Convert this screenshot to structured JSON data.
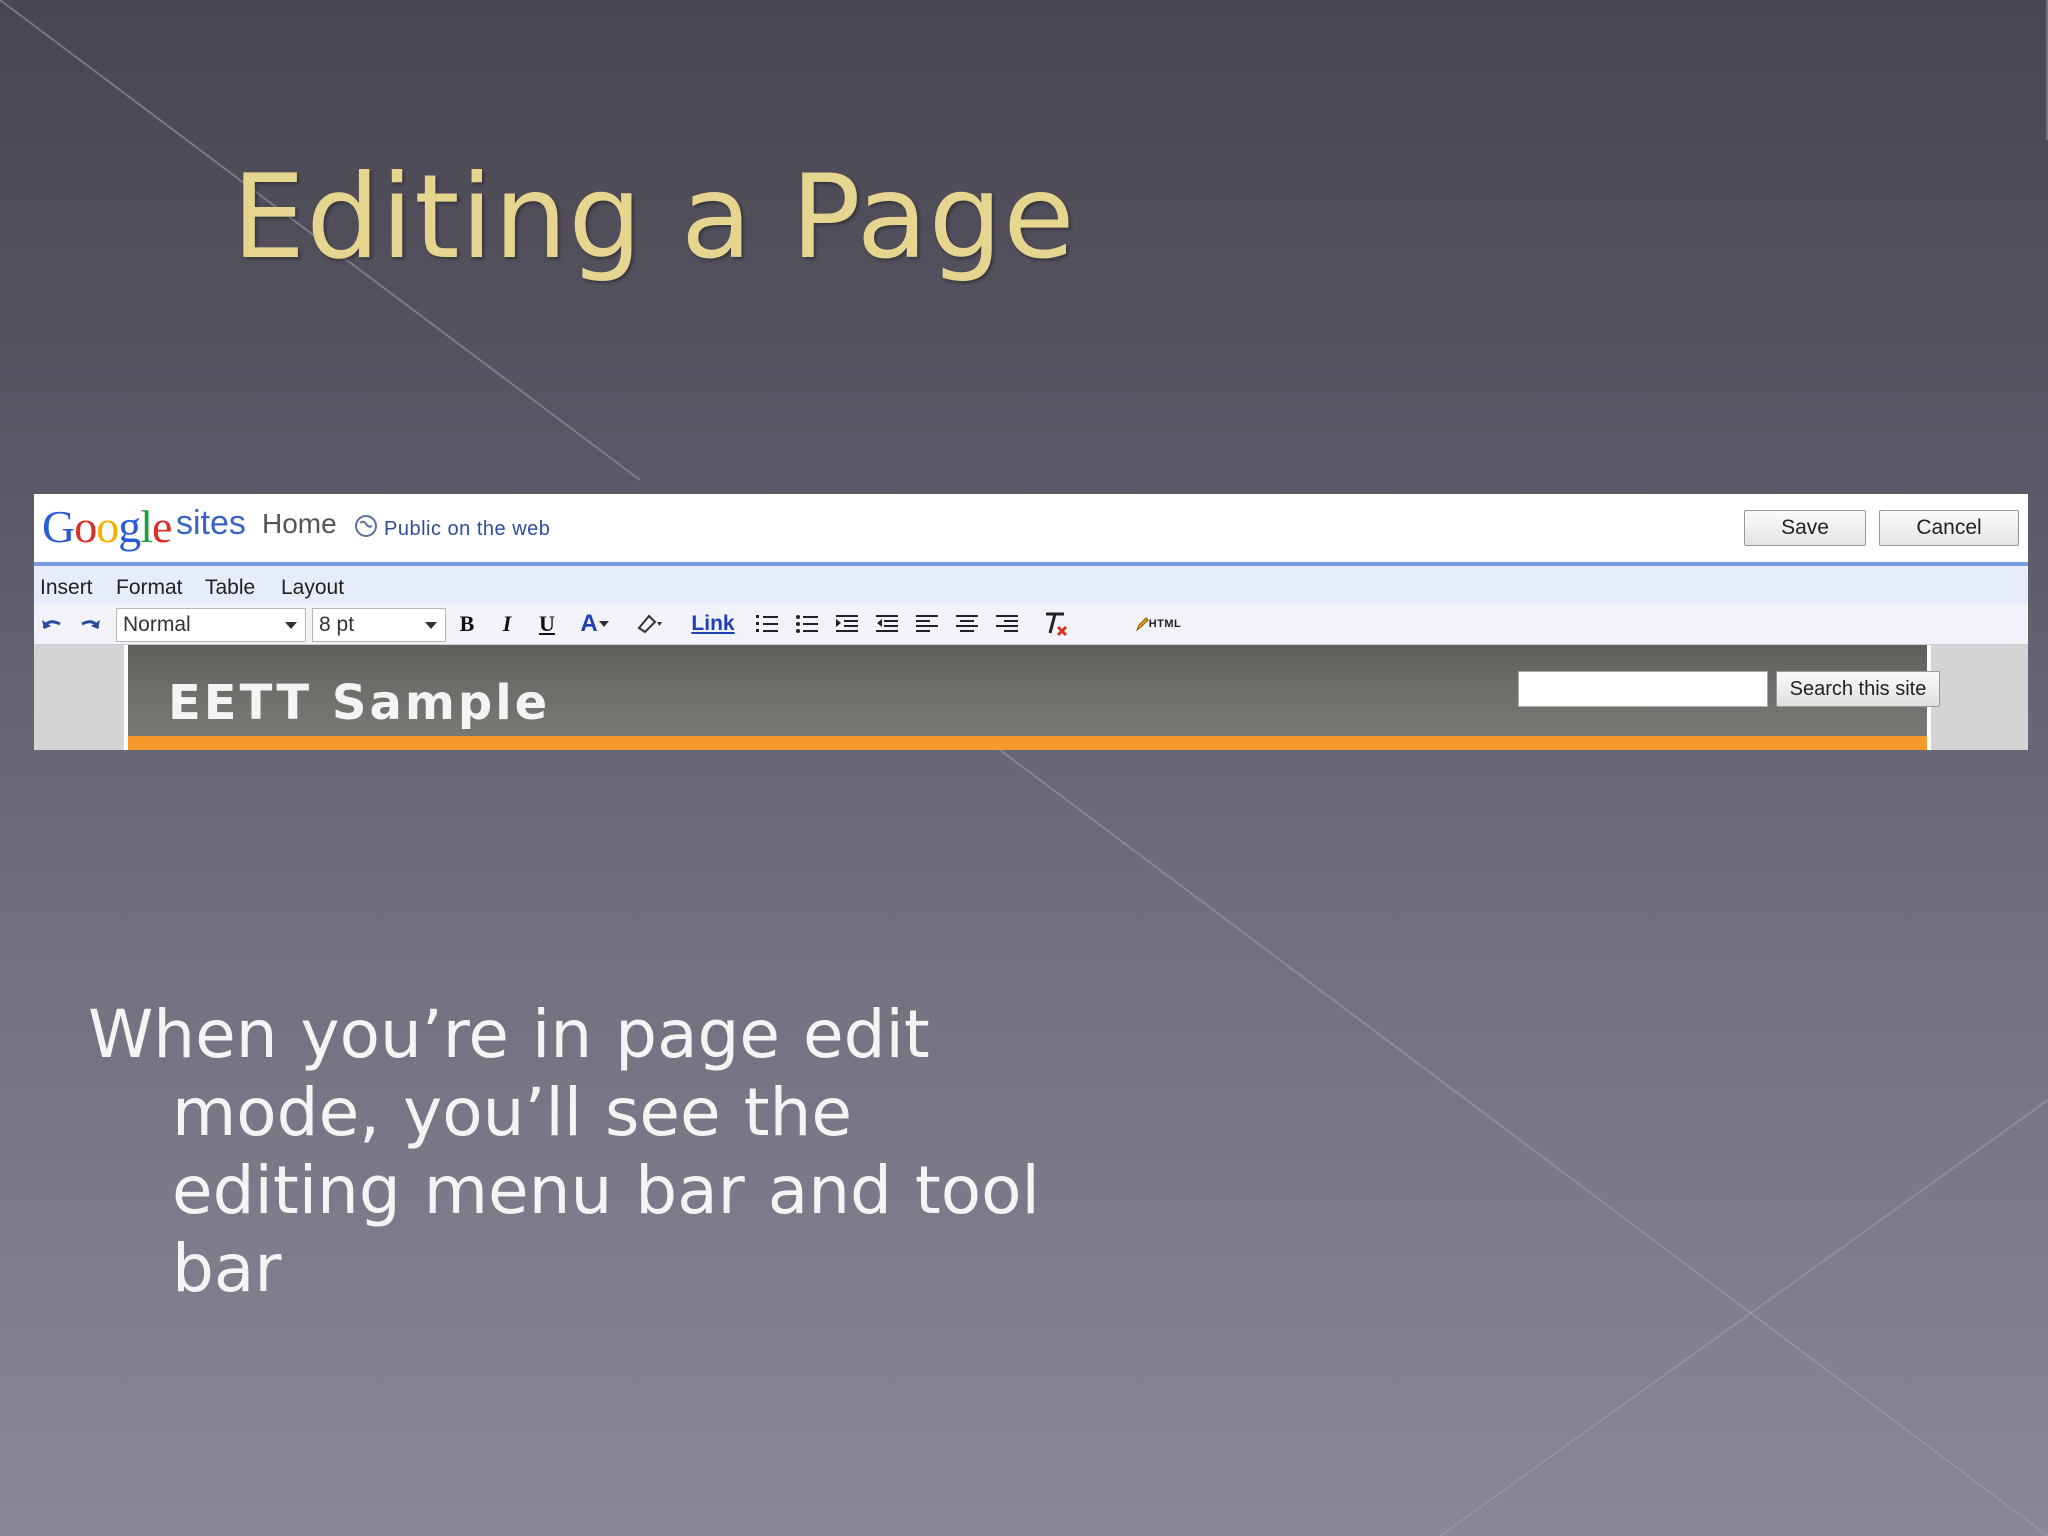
{
  "slide": {
    "title": "Editing a Page",
    "body": "When you’re in page edit mode, you’ll see the editing menu bar and tool bar"
  },
  "google_sites": {
    "logo": {
      "G": "G",
      "o1": "o",
      "o2": "o",
      "g": "g",
      "l": "l",
      "e": "e"
    },
    "product": "sites",
    "page": "Home",
    "visibility": "Public on the web",
    "save_label": "Save",
    "cancel_label": "Cancel",
    "menu": [
      "Insert",
      "Format",
      "Table",
      "Layout"
    ],
    "toolbar": {
      "style_value": "Normal",
      "size_value": "8 pt",
      "bold": "B",
      "italic": "I",
      "underline": "U",
      "text_color": "A",
      "link": "Link",
      "html": "HTML"
    },
    "site_title": "EETT Sample",
    "search_button": "Search this site"
  },
  "colors": {
    "title": "#e6d58f",
    "accent_blue": "#7a9ae0",
    "site_orange": "#f79a2e"
  }
}
